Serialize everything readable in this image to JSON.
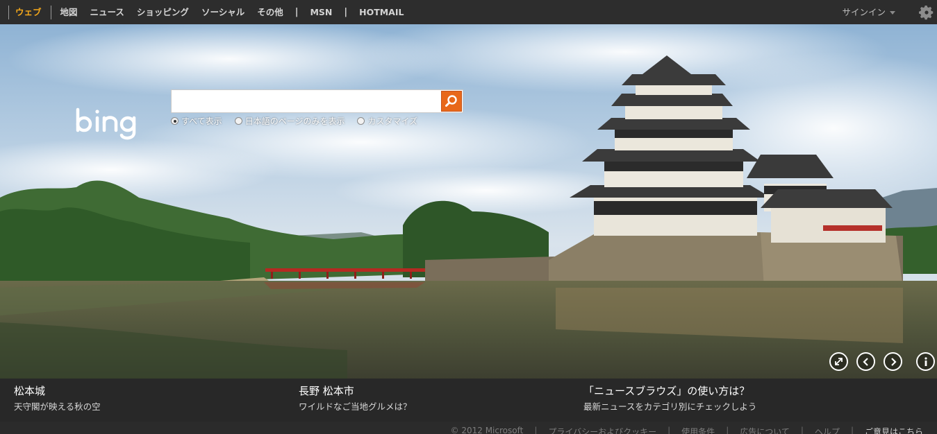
{
  "nav": {
    "items": [
      {
        "label": "ウェブ",
        "active": true
      },
      {
        "label": "地図"
      },
      {
        "label": "ニュース"
      },
      {
        "label": "ショッピング"
      },
      {
        "label": "ソーシャル"
      },
      {
        "label": "その他"
      }
    ],
    "pipe": "|",
    "msn": "MSN",
    "hotmail": "HOTMAIL",
    "signin": "サインイン"
  },
  "search": {
    "value": "",
    "scopes": [
      {
        "label": "すべて表示",
        "selected": true
      },
      {
        "label": "日本語のページのみを表示",
        "selected": false
      },
      {
        "label": "カスタマイズ",
        "selected": false
      }
    ]
  },
  "captions": [
    {
      "title": "松本城",
      "subtitle": "天守閣が映える秋の空"
    },
    {
      "title": "長野 松本市",
      "subtitle": "ワイルドなご当地グルメは？"
    },
    {
      "title": "「ニュースブラウズ」の使い方は？",
      "subtitle": "最新ニュースをカテゴリ別にチェックしよう"
    }
  ],
  "footer": {
    "copyright": "© 2012 Microsoft",
    "links": [
      "プライバシーおよびクッキー",
      "使用条件",
      "広告について",
      "ヘルプ",
      "ご意見はこちら"
    ]
  },
  "colors": {
    "accent": "#f4a81b",
    "search_button": "#e8681a",
    "nav_bg": "#2d2d2d"
  },
  "icons": {
    "search": "search-icon",
    "settings": "gear-icon",
    "fullscreen": "expand-icon",
    "prev": "chevron-left-icon",
    "next": "chevron-right-icon",
    "info": "info-icon"
  }
}
